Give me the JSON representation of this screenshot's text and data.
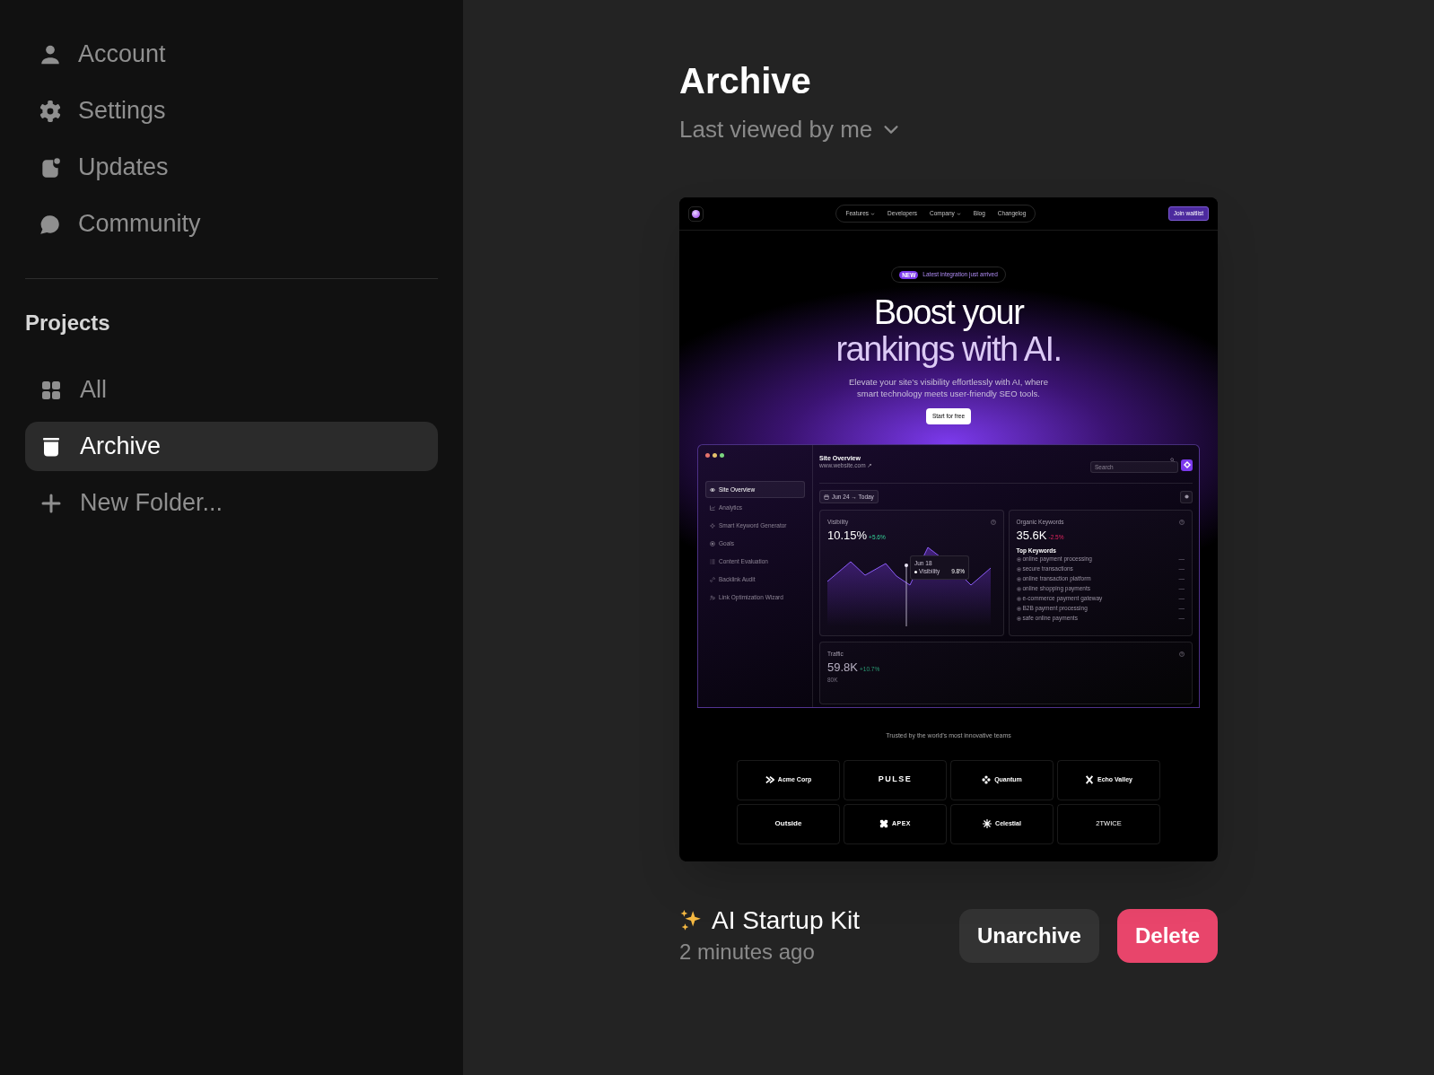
{
  "sidebar": {
    "items": [
      {
        "label": "Account"
      },
      {
        "label": "Settings"
      },
      {
        "label": "Updates"
      },
      {
        "label": "Community"
      }
    ],
    "section_title": "Projects",
    "projects": [
      {
        "label": "All",
        "selected": false
      },
      {
        "label": "Archive",
        "selected": true
      }
    ],
    "new_folder": "New Folder..."
  },
  "page": {
    "title": "Archive",
    "sort": "Last viewed by me"
  },
  "project": {
    "thumbnail": {
      "nav": [
        {
          "label": "Features",
          "has_menu": true
        },
        {
          "label": "Developers",
          "has_menu": false
        },
        {
          "label": "Company",
          "has_menu": true
        },
        {
          "label": "Blog",
          "has_menu": false
        },
        {
          "label": "Changelog",
          "has_menu": false
        }
      ],
      "cta_top": "Join waitlist",
      "badge": "NEW",
      "announcement": "Latest integration just arrived",
      "headline": [
        "Boost your",
        "rankings with AI."
      ],
      "subtext": [
        "Elevate your site’s visibility effortlessly with AI, where",
        "smart technology meets user-friendly SEO tools."
      ],
      "cta": "Start for free",
      "dashboard": {
        "nav": [
          {
            "label": "Site Overview",
            "selected": true
          },
          {
            "label": "Analytics",
            "selected": false
          },
          {
            "label": "Smart Keyword Generator",
            "selected": false
          },
          {
            "label": "Goals",
            "selected": false
          },
          {
            "label": "Content Evaluation",
            "selected": false
          },
          {
            "label": "Backlink Audit",
            "selected": false
          },
          {
            "label": "Link Optimization Wizard",
            "selected": false
          }
        ],
        "title": "Site Overview",
        "url": "www.website.com ↗",
        "search_placeholder": "Search",
        "date_range": "Jun 24 → Today",
        "visibility": {
          "label": "Visibility",
          "value": "10.15%",
          "delta": "+5.6%",
          "tooltip_date": "Jun 18",
          "tooltip_label": "Visibility",
          "tooltip_value": "9.8%"
        },
        "keywords": {
          "label": "Organic Keywords",
          "value": "35.6K",
          "delta": "-2.5%",
          "list_title": "Top Keywords",
          "items": [
            {
              "label": "online payment processing",
              "value": "—"
            },
            {
              "label": "secure transactions",
              "value": "—"
            },
            {
              "label": "online transaction platform",
              "value": "—"
            },
            {
              "label": "online shopping payments",
              "value": "—"
            },
            {
              "label": "e-commerce payment gateway",
              "value": "—"
            },
            {
              "label": "B2B payment processing",
              "value": "—"
            },
            {
              "label": "safe online payments",
              "value": "—"
            }
          ]
        },
        "traffic": {
          "label": "Traffic",
          "value": "59.8K",
          "delta": "+10.7%",
          "tick": "80K"
        }
      },
      "trusted": "Trusted by the world’s most innovative teams",
      "logos": [
        "Acme Corp",
        "PULSE",
        "Quantum",
        "Echo Valley",
        "Outside",
        "APEX",
        "Celestial",
        "2TWICE"
      ]
    },
    "name": "AI Startup Kit",
    "time": "2 minutes ago",
    "actions": [
      {
        "kind": "secondary",
        "label": "Unarchive"
      },
      {
        "kind": "danger",
        "label": "Delete"
      }
    ]
  }
}
